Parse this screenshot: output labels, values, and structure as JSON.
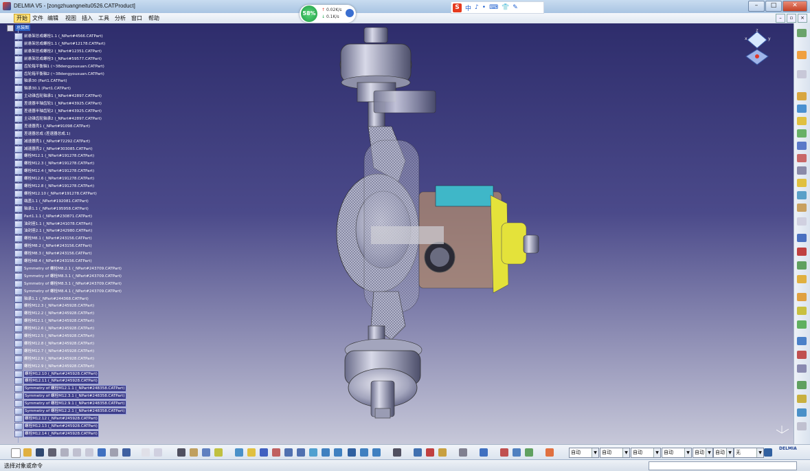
{
  "window": {
    "title": "DELMIA V5 - [zongzhuangneitu0526.CATProduct]",
    "buttons": [
      "–",
      "□",
      "✕"
    ]
  },
  "menu": {
    "items": [
      "开始",
      "文件",
      "编辑",
      "视图",
      "插入",
      "工具",
      "分析",
      "窗口",
      "帮助"
    ],
    "mdi_buttons": [
      "–",
      "▫",
      "×"
    ]
  },
  "speed_widget": {
    "percent": "58%",
    "up": "0.02K/s",
    "down": "0.1K/s"
  },
  "ime": {
    "logo": "S",
    "chars": [
      "中",
      "♪",
      "•",
      "⌨",
      "👕",
      "✎"
    ]
  },
  "tree": {
    "root": "总装图",
    "items": [
      "前悬架总成螺栓1.1 (_NPart#4566.CATPart)",
      "前悬架总成螺栓1.1 (_NPart#12178.CATPart)",
      "前悬架总成螺栓2 (_NPart#12351.CATPart)",
      "前悬架总成螺栓3 (_NPart#59577.CATPart)",
      "齿轮箱平衡轴1 (~38dengyouxuan.CATPart)",
      "齿轮箱平衡轴2 (~38dengyouxuan.CATPart)",
      "轴承30 (Part1.CATPart)",
      "轴承30.1 (Part1.CATPart)",
      "主动锥齿轮轴承1 (_NPart#42897.CATPart)",
      "差速器半轴齿轮1 (_NPart#43925.CATPart)",
      "差速器半轴齿轮2 (_NPart#43925.CATPart)",
      "主动锥齿轮轴承2 (_NPart#42897.CATPart)",
      "差速器壳1 (_NPart#91098.CATPart)",
      "差速器总成 (差速器总成.1)",
      "减速器壳1 (_NPart#72292.CATPart)",
      "减速器壳2 (_NPart#303085.CATPart)",
      "螺栓M12.1 (_NPart#191278.CATPart)",
      "螺栓M12.3 (_NPart#191278.CATPart)",
      "螺栓M12.4 (_NPart#191278.CATPart)",
      "螺栓M12.6 (_NPart#191278.CATPart)",
      "螺栓M12.8 (_NPart#191278.CATPart)",
      "螺栓M12.10 (_NPart#191278.CATPart)",
      "端盖1.1 (_NPart#192081.CATPart)",
      "轴承1.1 (_NPart#195958.CATPart)",
      "Part1.1.1 (_NPart#230871.CATPart)",
      "油封座1.1 (_NPart#241078.CATPart)",
      "油封座2.1 (_NPart#242980.CATPart)",
      "螺栓M8.1 (_NPart#243156.CATPart)",
      "螺栓M8.2 (_NPart#243156.CATPart)",
      "螺栓M8.3 (_NPart#243156.CATPart)",
      "螺栓M8.4 (_NPart#243156.CATPart)",
      "Symmetry of 螺栓M8.2.1 (_NPart#243709.CATPart)",
      "Symmetry of 螺栓M8.3.1 (_NPart#243709.CATPart)",
      "Symmetry of 螺栓M8.3.1 (_NPart#243709.CATPart)",
      "Symmetry of 螺栓M8.4.1 (_NPart#243709.CATPart)",
      "轴承1.1 (_NPart#244368.CATPart)",
      "螺栓M12.3 (_NPart#245928.CATPart)",
      "螺栓M12.2 (_NPart#245928.CATPart)",
      "螺栓M12.1 (_NPart#245928.CATPart)",
      "螺栓M12.6 (_NPart#245928.CATPart)",
      "螺栓M12.5 (_NPart#245928.CATPart)",
      "螺栓M12.8 (_NPart#245928.CATPart)",
      "螺栓M12.7 (_NPart#245928.CATPart)",
      "螺栓M12.9 (_NPart#245928.CATPart)",
      "螺栓M12.9 (_NPart#245928.CATPart)",
      "螺栓M12.10 (_NPart#245928.CATPart)",
      "螺栓M12.11 (_NPart#245928.CATPart)",
      "Symmetry of 螺栓M12.1.1 (_NPart#248358.CATPart)",
      "Symmetry of 螺栓M12.3.1 (_NPart#248358.CATPart)",
      "Symmetry of 螺栓M12.9.1 (_NPart#248358.CATPart)",
      "Symmetry of 螺栓M12.2.1 (_NPart#248358.CATPart)",
      "螺栓M12.12 (_NPart#245928.CATPart)",
      "螺栓M12.13 (_NPart#245928.CATPart)",
      "螺栓M12.14 (_NPart#245928.CATPart)"
    ]
  },
  "toolbar_combos": [
    "自动",
    "自动",
    "自动",
    "自动",
    "自动",
    "自动",
    "无"
  ],
  "delmia_logo": "DELMIA",
  "status": {
    "message": "选择对象或命令"
  },
  "compass": {
    "axis_x": "x",
    "axis_y": "y",
    "axis_z": "z"
  },
  "colors": {
    "accent": "#2a5fc2",
    "part_yellow": "#e4e23a",
    "part_cyan": "#3fb7c8"
  }
}
